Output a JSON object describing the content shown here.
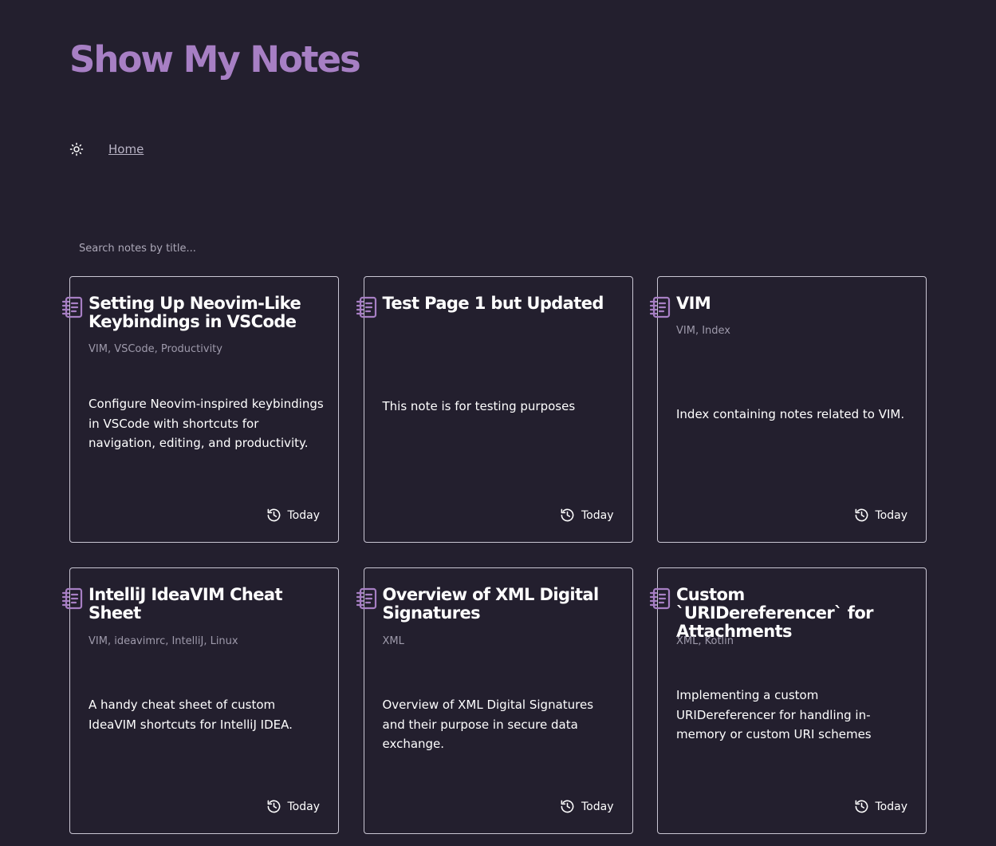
{
  "site": {
    "title": "Show My Notes",
    "accent": "#a77fc4",
    "background": "#231f2e"
  },
  "nav": {
    "theme_toggle_icon": "sun-icon",
    "home_label": "Home"
  },
  "search": {
    "placeholder": "Search notes by title...",
    "value": ""
  },
  "notes": [
    {
      "title": "Setting Up Neovim-Like Keybindings in VSCode",
      "tags": "VIM, VSCode, Productivity",
      "description": "Configure Neovim-inspired keybindings in VSCode with shortcuts for navigation, editing, and productivity.",
      "updated": "Today",
      "icon": "notebook-icon",
      "date_icon": "history-icon"
    },
    {
      "title": "Test Page 1 but Updated",
      "tags": "",
      "description": "This note is for testing purposes",
      "updated": "Today",
      "icon": "notebook-icon",
      "date_icon": "history-icon"
    },
    {
      "title": "VIM",
      "tags": "VIM, Index",
      "description": "Index containing notes related to VIM.",
      "updated": "Today",
      "icon": "notebook-icon",
      "date_icon": "history-icon"
    },
    {
      "title": "IntelliJ IdeaVIM Cheat Sheet",
      "tags": "VIM, ideavimrc, IntelliJ, Linux",
      "description": "A handy cheat sheet of custom IdeaVIM shortcuts for IntelliJ IDEA.",
      "updated": "Today",
      "icon": "notebook-icon",
      "date_icon": "history-icon"
    },
    {
      "title": "Overview of XML Digital Signatures",
      "tags": "XML",
      "description": "Overview of XML Digital Signatures and their purpose in secure data exchange.",
      "updated": "Today",
      "icon": "notebook-icon",
      "date_icon": "history-icon"
    },
    {
      "title": "Custom `URIDereferencer` for Attachments",
      "tags": "XML, Kotlin",
      "description": "Implementing a custom URIDereferencer for handling in-memory or custom URI schemes",
      "updated": "Today",
      "icon": "notebook-icon",
      "date_icon": "history-icon"
    }
  ]
}
